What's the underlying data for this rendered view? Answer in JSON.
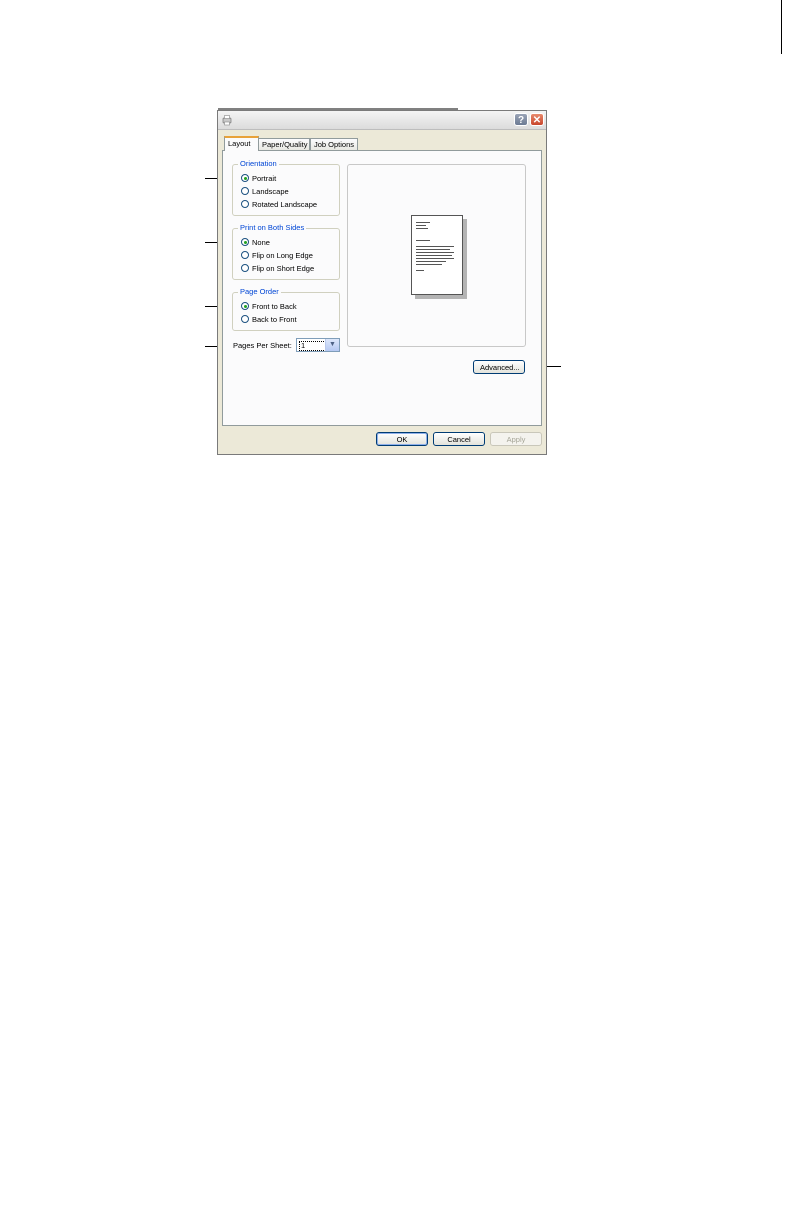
{
  "dialog": {
    "tabs": [
      {
        "label": "Layout"
      },
      {
        "label": "Paper/Quality"
      },
      {
        "label": "Job Options"
      }
    ],
    "orientation": {
      "title": "Orientation",
      "options": [
        {
          "label": "Portrait",
          "checked": true
        },
        {
          "label": "Landscape",
          "checked": false
        },
        {
          "label": "Rotated Landscape",
          "checked": false
        }
      ]
    },
    "print_both_sides": {
      "title": "Print on Both Sides",
      "options": [
        {
          "label": "None",
          "checked": true
        },
        {
          "label": "Flip on Long Edge",
          "checked": false
        },
        {
          "label": "Flip on Short Edge",
          "checked": false
        }
      ]
    },
    "page_order": {
      "title": "Page Order",
      "options": [
        {
          "label": "Front to Back",
          "checked": true
        },
        {
          "label": "Back to Front",
          "checked": false
        }
      ]
    },
    "pages_per_sheet": {
      "label": "Pages Per Sheet:",
      "value": "1"
    },
    "buttons": {
      "advanced": "Advanced...",
      "ok": "OK",
      "cancel": "Cancel",
      "apply": "Apply"
    },
    "titlebar": {
      "help": "?",
      "close": "✕"
    }
  },
  "colors": {
    "group_title": "#0046d5",
    "radio_dot": "#21a121",
    "active_tab_accent": "#e8a23a",
    "close_button": "#c8452b"
  }
}
